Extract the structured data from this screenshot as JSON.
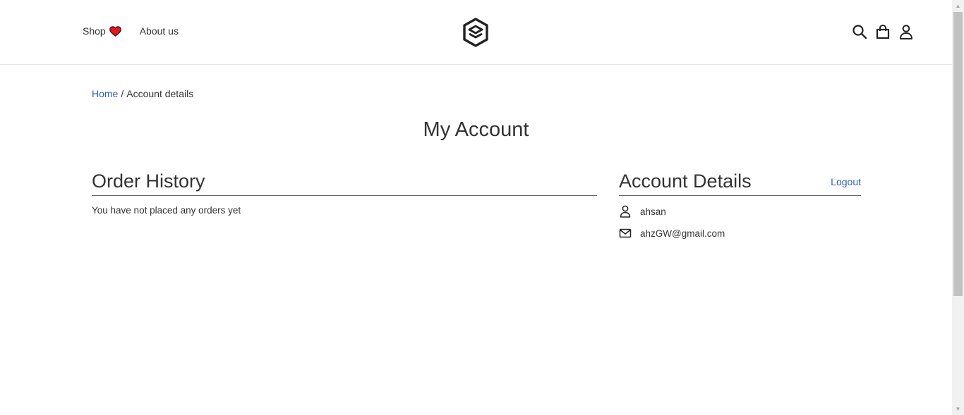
{
  "header": {
    "nav_left": [
      {
        "label": "Shop"
      },
      {
        "label": "About us"
      }
    ],
    "icons": [
      "heart-icon",
      "logo-icon",
      "search-icon",
      "bag-icon",
      "user-icon"
    ],
    "heart_color": "#e8141e"
  },
  "breadcrumb": {
    "home": "Home",
    "separator": "/",
    "current": "Account details"
  },
  "page": {
    "title": "My Account"
  },
  "order_history": {
    "title": "Order History",
    "empty_message": "You have not placed any orders yet"
  },
  "account_details": {
    "title": "Account Details",
    "logout_label": "Logout",
    "username": "ahsan",
    "email": "ahzGW@gmail.com"
  },
  "colors": {
    "link": "#2f5fb3",
    "text": "#333333",
    "divider": "#666666"
  }
}
